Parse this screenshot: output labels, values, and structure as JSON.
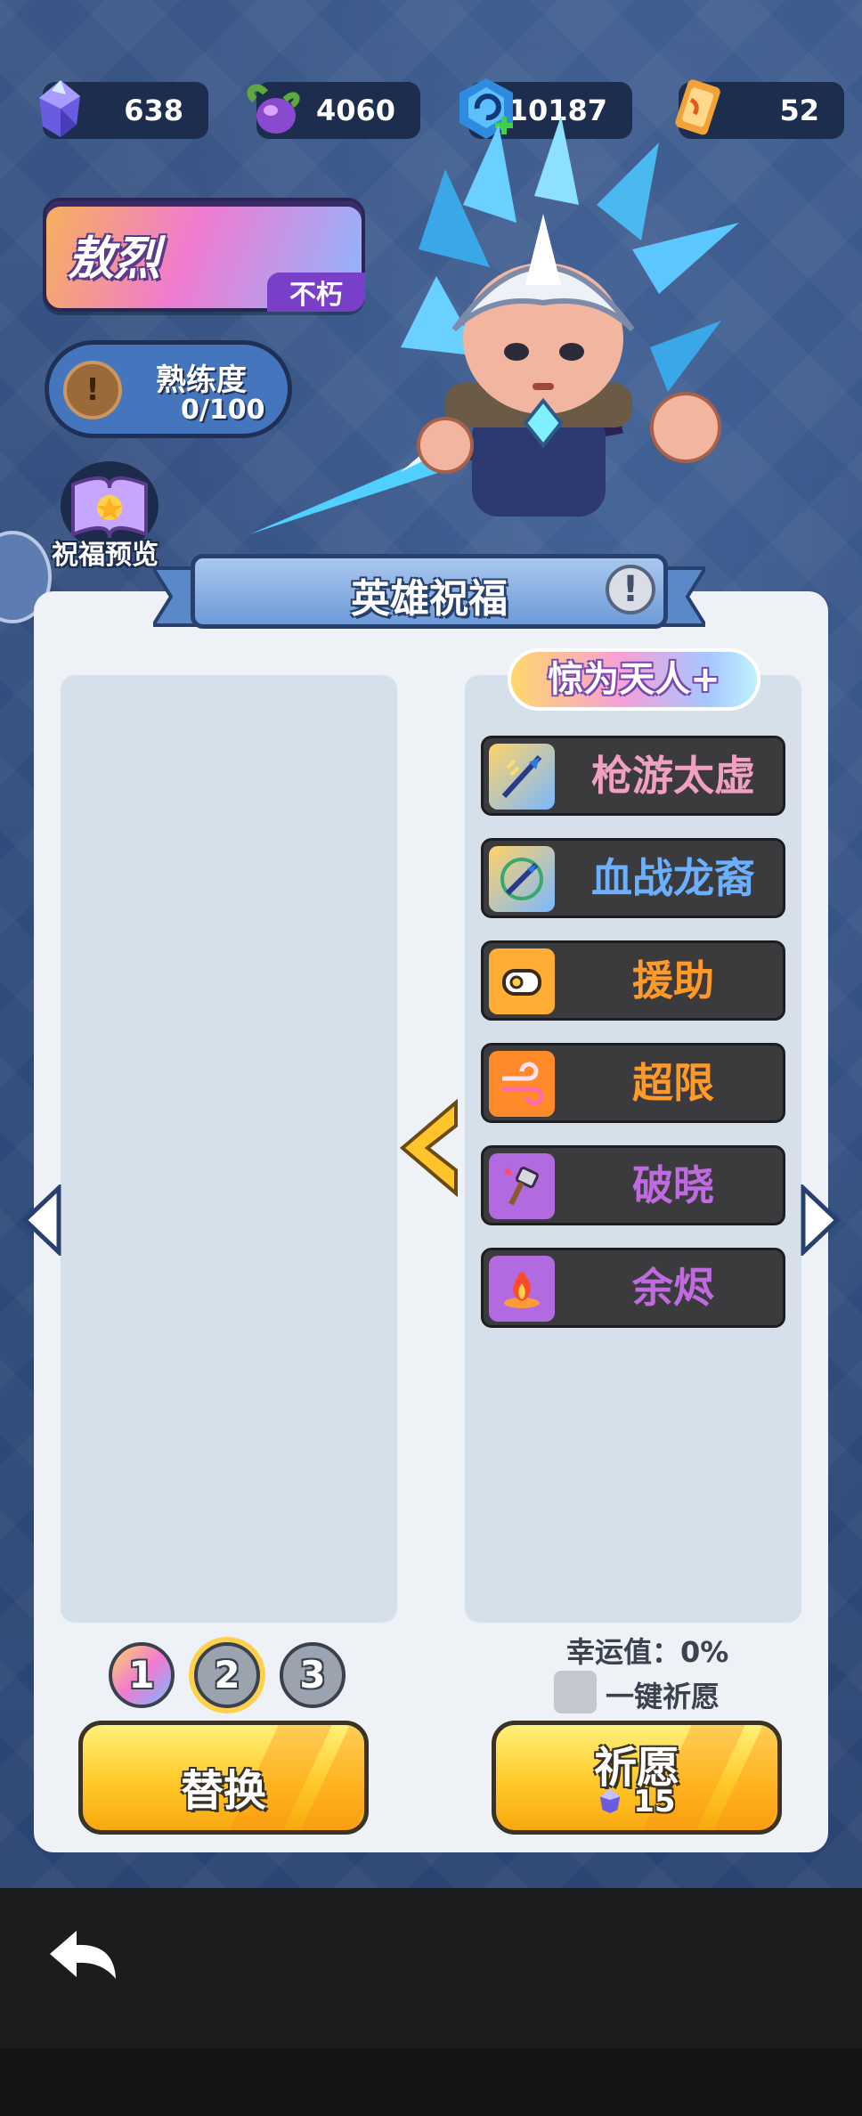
{
  "currencies": [
    {
      "icon": "crystal-icon",
      "value": "638"
    },
    {
      "icon": "potion-icon",
      "value": "4060"
    },
    {
      "icon": "energy-icon",
      "value": "10187"
    },
    {
      "icon": "ticket-icon",
      "value": "52"
    }
  ],
  "hero": {
    "name": "敖烈",
    "rank": "不朽",
    "proficiency_label": "熟练度",
    "proficiency_value": "0/100",
    "proficiency_progress": 0
  },
  "preview": {
    "label": "祝福预览"
  },
  "panel": {
    "title": "英雄祝福",
    "tier": "惊为天人+",
    "skills": [
      {
        "name": "枪游太虚",
        "color": "#f0a0c0",
        "icon": "spear-icon"
      },
      {
        "name": "血战龙裔",
        "color": "#6ab0ff",
        "icon": "crossed-spear-icon"
      },
      {
        "name": "援助",
        "color": "#ff9a2a",
        "icon": "assist-icon"
      },
      {
        "name": "超限",
        "color": "#ff9a2a",
        "icon": "wind-icon"
      },
      {
        "name": "破晓",
        "color": "#c06ae0",
        "icon": "hammer-icon"
      },
      {
        "name": "余烬",
        "color": "#c06ae0",
        "icon": "fire-icon"
      }
    ]
  },
  "pages": [
    "1",
    "2",
    "3"
  ],
  "selected_page": "2",
  "luck": {
    "label": "幸运值：0%"
  },
  "one_key": {
    "label": "一键祈愿",
    "checked": false
  },
  "buttons": {
    "replace": "替换",
    "wish": "祈愿",
    "wish_cost": "15"
  }
}
